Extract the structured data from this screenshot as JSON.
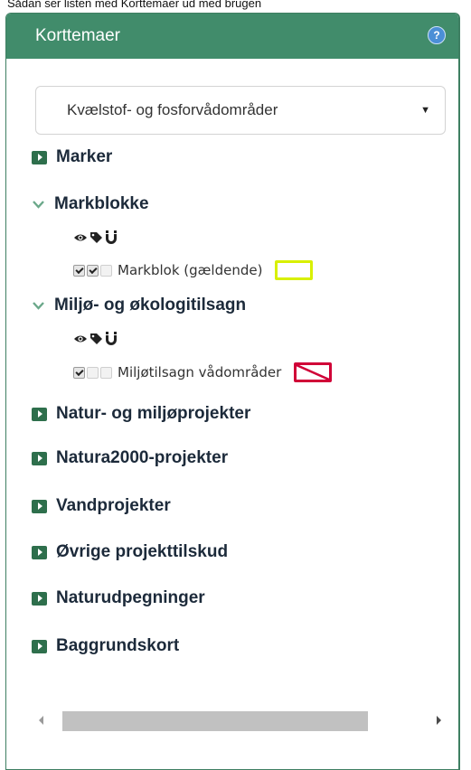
{
  "caption": "Sådan ser listen med Korttemaer ud med brugen",
  "panel": {
    "title": "Korttemaer",
    "help_icon": "question-circle-icon"
  },
  "theme_select": {
    "value": "Kvælstof- og fosforvådområder",
    "arrow": "▼"
  },
  "groups": [
    {
      "label": "Marker",
      "state": "collapsed"
    },
    {
      "label": "Markblokke",
      "state": "expanded"
    },
    {
      "label": "Miljø- og økologitilsagn",
      "state": "expanded"
    },
    {
      "label": "Natur- og miljøprojekter",
      "state": "collapsed"
    },
    {
      "label": "Natura2000-projekter",
      "state": "collapsed"
    },
    {
      "label": "Vandprojekter",
      "state": "collapsed"
    },
    {
      "label": "Øvrige projekttilskud",
      "state": "collapsed"
    },
    {
      "label": "Naturudpegninger",
      "state": "collapsed"
    },
    {
      "label": "Baggrundskort",
      "state": "collapsed"
    }
  ],
  "tool_icons": [
    "eye-icon",
    "tag-icon",
    "magnet-icon"
  ],
  "layers": {
    "markblok": {
      "label": "Markblok (gældende)",
      "visible": true,
      "labels": true,
      "snap": false,
      "legend_color": "#d8f000"
    },
    "miljotilsagn": {
      "label": "Miljøtilsagn vådområder",
      "visible": true,
      "labels": false,
      "snap": false,
      "legend_color": "#d00037"
    }
  },
  "colors": {
    "header_bg": "#418c6b",
    "expand_icon": "#2e6f4c",
    "help_icon": "#4b8fd6"
  }
}
